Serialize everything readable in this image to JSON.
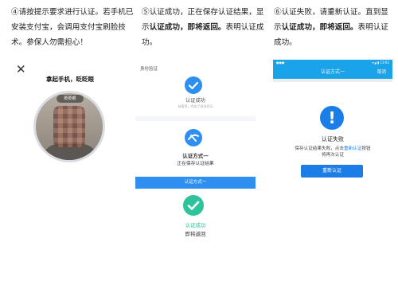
{
  "captions": {
    "step4": "④请按提示要求进行认证。若手机已安装支付宝，会调用支付宝刷脸技术。参保人勿需担心！",
    "step5_before": "⑤认证成功，正在保存认证结果，显示",
    "step5_bold": "认证成功，即将返回。",
    "step5_after": "表明认证成功。",
    "step6_before": "⑥认证失败，请重新认证。直到显示",
    "step6_bold": "认证成功，即将返回。",
    "step6_after": "表明认证成功。"
  },
  "panel1": {
    "close_icon": "close-icon",
    "instruction": "拿起手机，眨眨眼",
    "blink_tag": "眨眨眼"
  },
  "panel2": {
    "header": "身份验证",
    "success_label": "认证成功",
    "success_hint": "恭喜您，完成了身份验证",
    "method_label": "认证方式一",
    "saving_label": "正在保存认证结果",
    "blue_bar_label": "认证方式一",
    "success_label_2": "认证成功",
    "returning_label": "即将返回"
  },
  "panel3": {
    "status_left": "●●●",
    "status_right": "▾◢ ▮ 13:02",
    "title": "认证方式一",
    "cancel": "取消",
    "alert_symbol": "!",
    "fail_title": "认证失败",
    "msg_before": "保存认证结果失败，点击",
    "msg_link": "重新认证",
    "msg_after": "按钮",
    "msg_line2": "将再次认证",
    "retry_button": "重新认证"
  },
  "colors": {
    "blue": "#2f8ff0",
    "green": "#2ec39a",
    "header_blue": "#1aa3e8",
    "button_blue": "#1a7ee6"
  }
}
